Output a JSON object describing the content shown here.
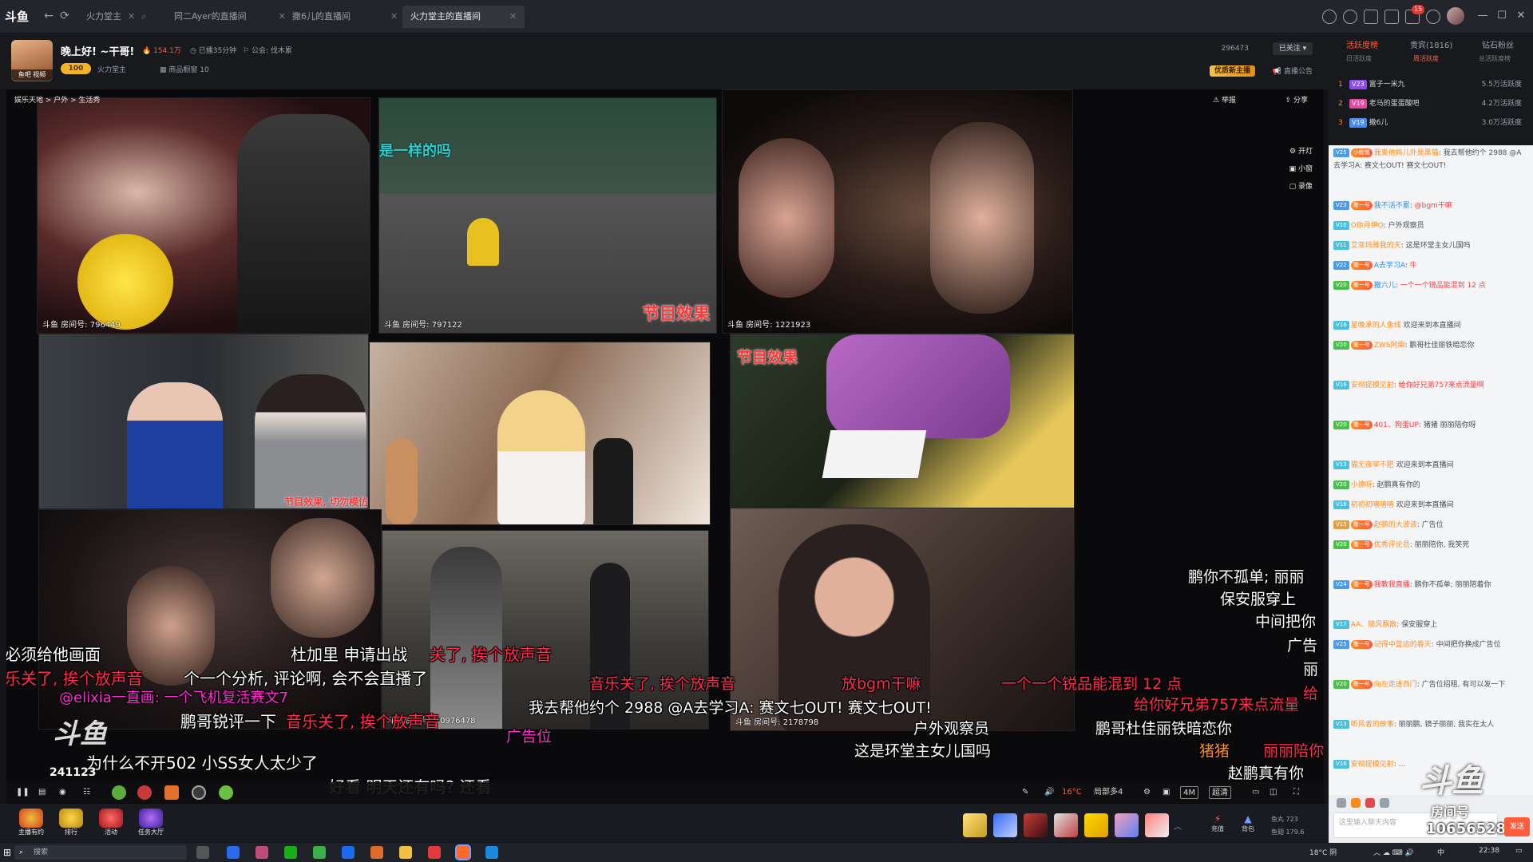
{
  "titlebar": {
    "logo": "斗鱼",
    "tabs": [
      {
        "label": "火力堂主",
        "active": false
      },
      {
        "label": "同二Ayer的直播间",
        "active": false
      },
      {
        "label": "撒6儿的直播间",
        "active": false
      },
      {
        "label": "火力堂主的直播间",
        "active": true
      }
    ],
    "notif_count": "15"
  },
  "streamer": {
    "title": "晚上好! ~干哥!",
    "hot": "154.1万",
    "duration": "已播35分钟",
    "announcement": "公会: 伐木累",
    "level": "100",
    "name": "火力堂主",
    "product": "商品橱窗 10",
    "avatar_caption": "鱼吧 视频",
    "follow_count": "296473",
    "follow_label": "已关注",
    "badge": "优质新主播",
    "notice": "直播公告"
  },
  "player": {
    "breadcrumb": "娱乐天地 > 户外 > 生活秀",
    "report": "举报",
    "share": "分享",
    "side_tools": [
      "开灯",
      "小窗",
      "录像"
    ],
    "tiles": {
      "t1_room": "斗鱼 房间号: 796449",
      "t2_room": "斗鱼 房间号: 797122",
      "t2_overlay": "是一样的吗",
      "t2_tag": "节目效果",
      "t3_room": "斗鱼 房间号: 1221923",
      "t5_tag": "节目效果, 切勿模仿",
      "t7_tag": "节目效果",
      "t9_room": "斗鱼 房间号: 10976478",
      "t10_room": "斗鱼 房间号: 2178798",
      "t8_room": "241123"
    },
    "danmu": [
      {
        "text": "必须给他画面",
        "color": "w"
      },
      {
        "text": "乐关了, 挨个放声音",
        "color": "r"
      },
      {
        "text": "杜加里 申请出战",
        "color": "w"
      },
      {
        "text": "关了, 挨个放声音",
        "color": "r"
      },
      {
        "text": "个一个分析, 评论啊, 会不会直播了",
        "color": "w"
      },
      {
        "text": "@elixia一直画: 一个飞机复活赛文7",
        "color": "m"
      },
      {
        "text": "鹏哥锐评一下",
        "color": "w"
      },
      {
        "text": "音乐关了, 挨个放声音",
        "color": "r"
      },
      {
        "text": "为什么不开502 小SS女人太少了",
        "color": "w"
      },
      {
        "text": "好看 明天还有吗? 还看",
        "color": "w"
      },
      {
        "text": "音乐关了, 挨个放声音",
        "color": "r"
      },
      {
        "text": "放bgm干嘛",
        "color": "r"
      },
      {
        "text": "我去帮他约个 2988 @A去学习A: 赛文七OUT! 赛文七OUT!",
        "color": "w"
      },
      {
        "text": "广告位",
        "color": "m"
      },
      {
        "text": "户外观察员",
        "color": "w"
      },
      {
        "text": "这是环堂主女儿国吗",
        "color": "w"
      },
      {
        "text": "一个一个锐品能混到 12 点",
        "color": "r"
      },
      {
        "text": "给你好兄弟757来点流量",
        "color": "r"
      },
      {
        "text": "鹏哥杜佳丽铁暗恋你",
        "color": "w"
      },
      {
        "text": "猪猪",
        "color": "o"
      },
      {
        "text": "丽丽陪你",
        "color": "r"
      },
      {
        "text": "赵鹏真有你",
        "color": "w"
      },
      {
        "text": "鹏你不孤单; 丽丽",
        "color": "w"
      },
      {
        "text": "保安服穿上",
        "color": "w"
      },
      {
        "text": "中间把你",
        "color": "w"
      },
      {
        "text": "广告",
        "color": "w"
      },
      {
        "text": "丽",
        "color": "w"
      },
      {
        "text": "给",
        "color": "r"
      }
    ],
    "watermark": "斗鱼",
    "watermark_sub": "房间号"
  },
  "controls": {
    "temp": "16°C",
    "quality": "4M",
    "res": "超清",
    "fps": "局部多4"
  },
  "giftbar": {
    "items": [
      "主播有约",
      "排行",
      "活动",
      "任务大厅"
    ],
    "recharge": "充值",
    "backpack": "背包",
    "fish_ball": "鱼丸 723",
    "fish_wing": "鱼翅 179.6"
  },
  "rank": {
    "tabs": [
      "活跃度榜",
      "贵宾(1816)",
      "钻石粉丝"
    ],
    "subtabs": [
      "日活跃度",
      "周活跃度",
      "总活跃度榜"
    ],
    "rows": [
      {
        "num": "1",
        "name": "富子一米九",
        "score": "5.5万活跃度"
      },
      {
        "num": "2",
        "name": "老马的蛋蛋酸吧",
        "score": "4.2万活跃度"
      },
      {
        "num": "3",
        "name": "撒6儿",
        "score": "3.0万活跃度"
      }
    ]
  },
  "chat": {
    "messages": [
      {
        "user": "我爱他妈儿外是黑猫",
        "text": "我去帮他约个 2988 @A去学习A: 赛文七OUT! 赛文七OUT!"
      },
      {
        "user": "我不活不累",
        "text": "@bgm干嘛"
      },
      {
        "user": "O你月伊O",
        "text": "户外观察员"
      },
      {
        "user": "艾亚玛雅我的天",
        "text": "这是环堂主女儿国吗"
      },
      {
        "user": "A去学习A",
        "text": "牛"
      },
      {
        "user": "撒六儿",
        "text": "一个一个锐品能混到 12 点"
      },
      {
        "user": "星晚承的人鱼线",
        "text": "欢迎来到本直播间"
      },
      {
        "user": "ZWS阿柴",
        "text": "鹏哥杜佳丽铁暗恋你"
      },
      {
        "user": "安彻提模见射",
        "text": "给你好兄弟757来点流量啊"
      },
      {
        "user": "401、狗蛋UP",
        "text": "猪猪 丽丽陪你呀"
      },
      {
        "user": "猫无夜宰不肥",
        "text": "欢迎来到本直播间"
      },
      {
        "user": "小德呀",
        "text": "赵鹏真有你的"
      },
      {
        "user": "初初初嘻嘻嘻",
        "text": "欢迎来到本直播间"
      },
      {
        "user": "赵鹏的大波波",
        "text": "广告位"
      },
      {
        "user": "优秀评论员",
        "text": "丽丽陪你, 我笑死"
      },
      {
        "user": "我教我直播",
        "text": "鹏你不孤单; 丽丽陪着你"
      },
      {
        "user": "AA、随风飘散",
        "text": "保安服穿上"
      },
      {
        "user": "记得中蓝远的春天",
        "text": "中间把你换成广告位"
      },
      {
        "user": "向左走进西门",
        "text": "广告位招租, 有可以发一下"
      },
      {
        "user": "听风者的故事",
        "text": "丽丽鹏, 镜子丽丽, 我实在太人"
      },
      {
        "user": "安彻提模见射",
        "text": "..."
      }
    ]
  },
  "chat_bottom": {
    "room_no": "10656528",
    "send": "发送",
    "placeholder": "这里输入聊天内容"
  },
  "taskbar": {
    "search": "搜索",
    "weather": "18°C 阴",
    "lang": "中",
    "time": "22:38"
  }
}
